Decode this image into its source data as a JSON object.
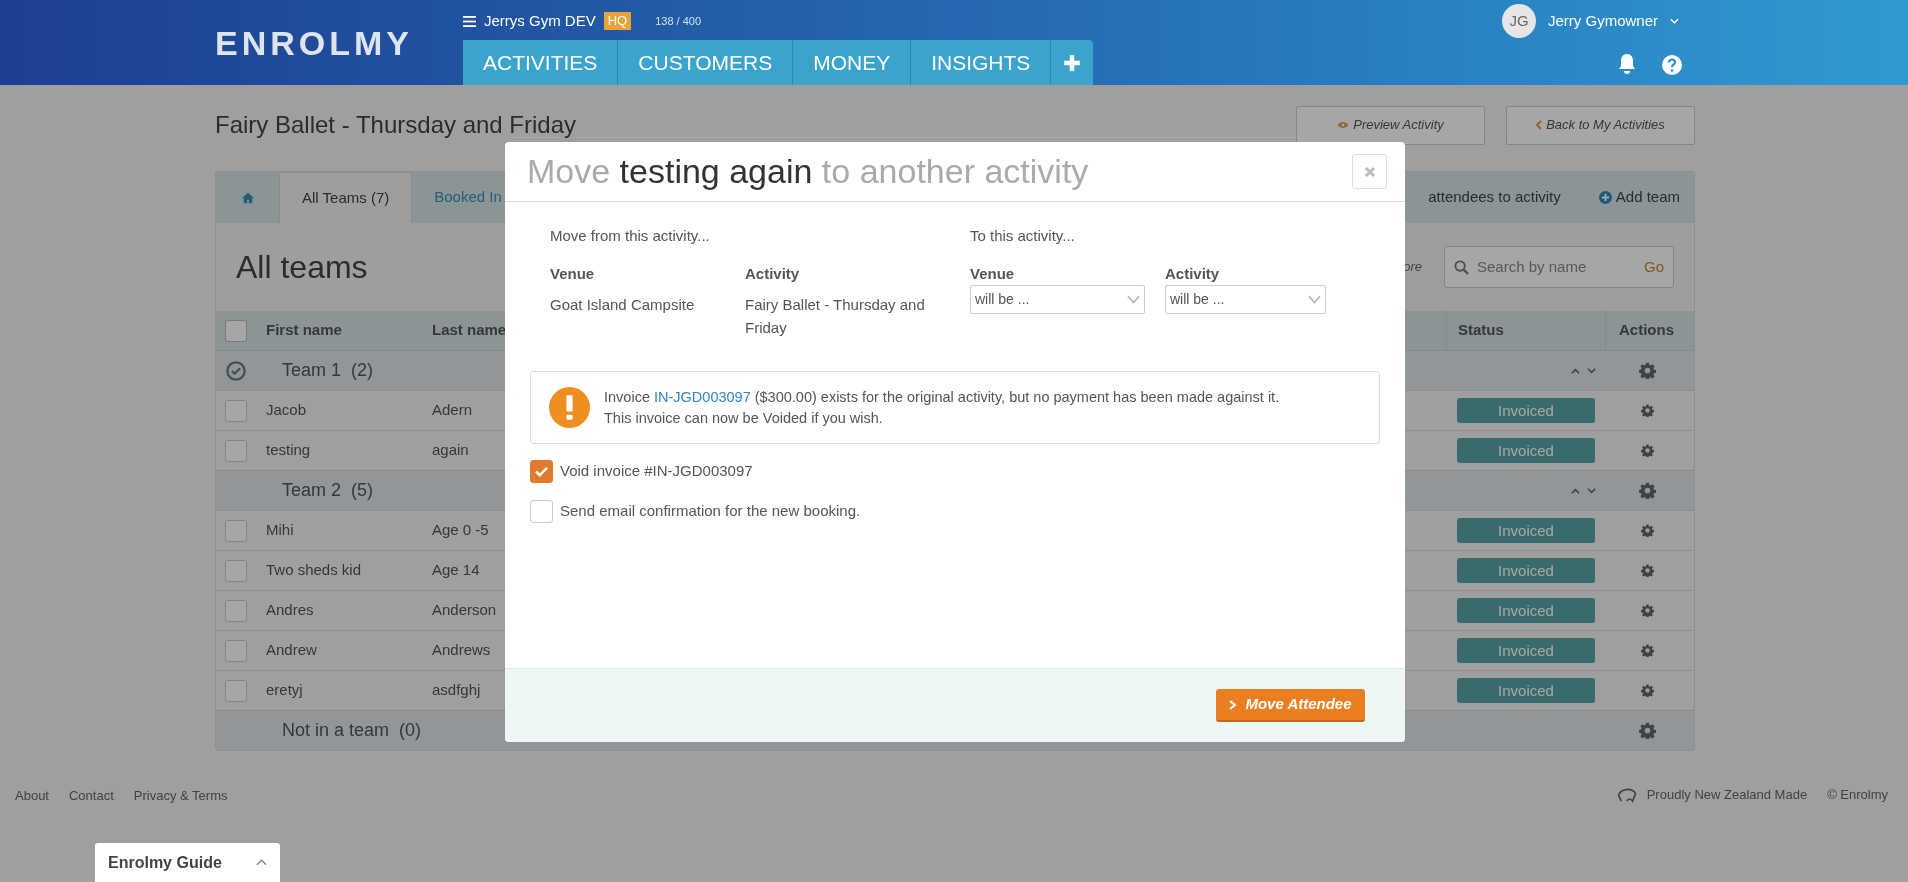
{
  "header": {
    "logo": "ENROLMY",
    "org": "Jerrys Gym DEV",
    "org_badge": "HQ",
    "usage": "138 / 400",
    "nav": [
      {
        "label": "ACTIVITIES",
        "selected": false
      },
      {
        "label": "CUSTOMERS",
        "selected": false
      },
      {
        "label": "MONEY",
        "selected": false
      },
      {
        "label": "INSIGHTS",
        "selected": false
      }
    ],
    "user": {
      "initials": "JG",
      "name": "Jerry Gymowner"
    }
  },
  "page": {
    "title": "Fairy Ballet - Thursday and Friday",
    "buttons": [
      "Preview Activity",
      "Back to My Activities"
    ]
  },
  "panel": {
    "tabs": [
      {
        "kind": "home",
        "selected": false
      },
      {
        "kind": "text",
        "label": "All Teams (7)",
        "selected": true
      },
      {
        "kind": "text",
        "label": "Booked In",
        "selected": false
      }
    ],
    "actions": [
      "attendees to activity",
      "Add team"
    ],
    "heading": "All teams",
    "partial_link": "ore",
    "search": {
      "placeholder": "Search by name",
      "go": "Go"
    },
    "table": {
      "select_all_checked": false,
      "columns": [
        "First name",
        "Last name",
        "Status",
        "Actions"
      ],
      "rows": [
        {
          "kind": "team",
          "name": "Team 1",
          "count": "(2)",
          "checked": true,
          "reorderable": true
        },
        {
          "kind": "attendee",
          "first": "Jacob",
          "last": "Adern",
          "status": "Invoiced",
          "checked": false
        },
        {
          "kind": "attendee",
          "first": "testing",
          "last": "again",
          "status": "Invoiced",
          "checked": false
        },
        {
          "kind": "team",
          "name": "Team 2",
          "count": "(5)",
          "checked": false,
          "reorderable": true
        },
        {
          "kind": "attendee",
          "first": "Mihi",
          "last": "Age 0 -5",
          "status": "Invoiced",
          "checked": false
        },
        {
          "kind": "attendee",
          "first": "Two sheds kid",
          "last": "Age 14",
          "status": "Invoiced",
          "checked": false
        },
        {
          "kind": "attendee",
          "first": "Andres",
          "last": "Anderson",
          "status": "Invoiced",
          "checked": false
        },
        {
          "kind": "attendee",
          "first": "Andrew",
          "last": "Andrews",
          "status": "Invoiced",
          "checked": false
        },
        {
          "kind": "attendee",
          "first": "eretyj",
          "last": "asdfghj",
          "status": "Invoiced",
          "checked": false
        },
        {
          "kind": "team",
          "name": "Not in a team",
          "count": "(0)",
          "checked": false,
          "reorderable": false
        }
      ]
    }
  },
  "modal": {
    "title": "Move **testing again** to another activity",
    "from": {
      "heading": "Move from this activity...",
      "venue_label": "Venue",
      "activity_label": "Activity",
      "venue": "Goat Island Campsite",
      "activity": "Fairy Ballet - Thursday and Friday"
    },
    "to": {
      "heading": "To this activity...",
      "fields": [
        {
          "label": "Venue",
          "value": "will be ..."
        },
        {
          "label": "Activity",
          "value": "will be ..."
        }
      ]
    },
    "alert": {
      "before": "Invoice",
      "link": "IN-JGD003097",
      "after": "($300.00) exists for the original activity, but no payment has been made against it.",
      "line2": "This invoice can now be Voided if you wish."
    },
    "options": [
      {
        "label": "Void invoice #IN-JGD003097",
        "checked": true
      },
      {
        "label": "Send email confirmation for the new booking.",
        "checked": false
      }
    ],
    "submit": "Move Attendee"
  },
  "footer": {
    "links": [
      "About",
      "Contact",
      "Privacy & Terms"
    ],
    "tagline": "Proudly New Zealand Made",
    "copyright": "© Enrolmy",
    "guide": "Enrolmy Guide"
  }
}
